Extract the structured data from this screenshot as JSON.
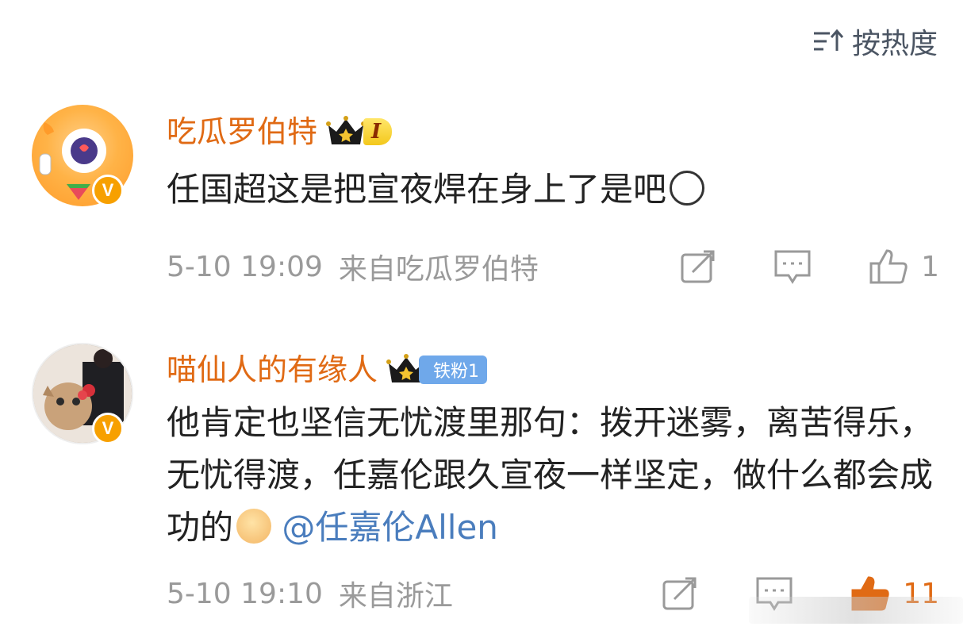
{
  "sort": {
    "label": "按热度"
  },
  "comments": [
    {
      "username": "吃瓜罗伯特",
      "badge": "I",
      "text": "任国超这是把宣夜焊在身上了是吧",
      "time": "5-10 19:09",
      "source": "来自吃瓜罗伯特",
      "likes": "1"
    },
    {
      "username": "喵仙人的有缘人",
      "badge": "铁粉1",
      "text": "他肯定也坚信无忧渡里那句：拨开迷雾，离苦得乐，无忧得渡，任嘉伦跟久宣夜一样坚定，做什么都会成功的",
      "mention": "@任嘉伦Allen",
      "time": "5-10 19:10",
      "source": "来自浙江",
      "likes": "11"
    }
  ],
  "colors": {
    "username": "#e06a14",
    "mention": "#4a7dbd",
    "meta": "#9a9a9a",
    "verified": "#f7a000",
    "fan_badge": "#6fa8ea"
  },
  "icons": {
    "sort": "sort-icon",
    "repost": "repost-icon",
    "comment": "comment-icon",
    "like": "thumbs-up-icon",
    "verified": "verified-v-icon",
    "crown": "crown-icon"
  }
}
